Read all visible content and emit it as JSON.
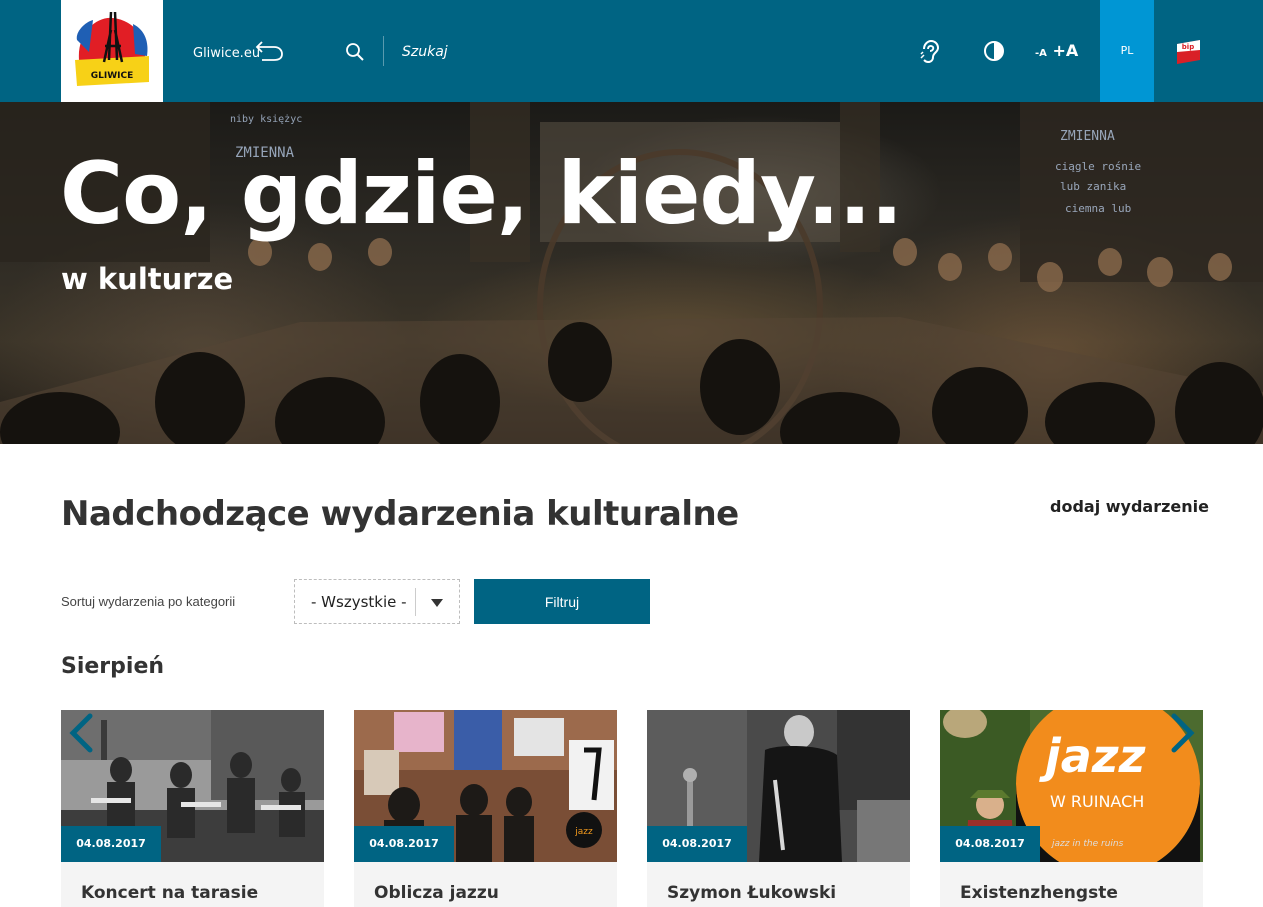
{
  "header": {
    "logo_text": "GLIWICE",
    "site_link": "Gliwice.eu",
    "search_placeholder": "Szukaj",
    "font_small": "A",
    "font_large": "A",
    "language": "PL",
    "bip_label": "bip",
    "colors": {
      "bar": "#006483",
      "lang_active": "#0096d4"
    }
  },
  "hero": {
    "title": "Co, gdzie, kiedy...",
    "subtitle": "w kulturze"
  },
  "events_section": {
    "title": "Nadchodzące wydarzenia kulturalne",
    "add_event_link": "dodaj wydarzenie",
    "filter_label": "Sortuj wydarzenia po kategorii",
    "filter_selected": "- Wszystkie -",
    "filter_button": "Filtruj",
    "month": "Sierpień"
  },
  "events": [
    {
      "date": "04.08.2017",
      "title": "Koncert na tarasie"
    },
    {
      "date": "04.08.2017",
      "title": "Oblicza jazzu"
    },
    {
      "date": "04.08.2017",
      "title": "Szymon Łukowski Quintet feat. Henryk Gembalski"
    },
    {
      "date": "04.08.2017",
      "title": "Existenzhengste"
    }
  ],
  "poster_text": {
    "jazz": "jazz",
    "w_ruinach": "W RUINACH",
    "tagline": "jazz in the ruins"
  }
}
